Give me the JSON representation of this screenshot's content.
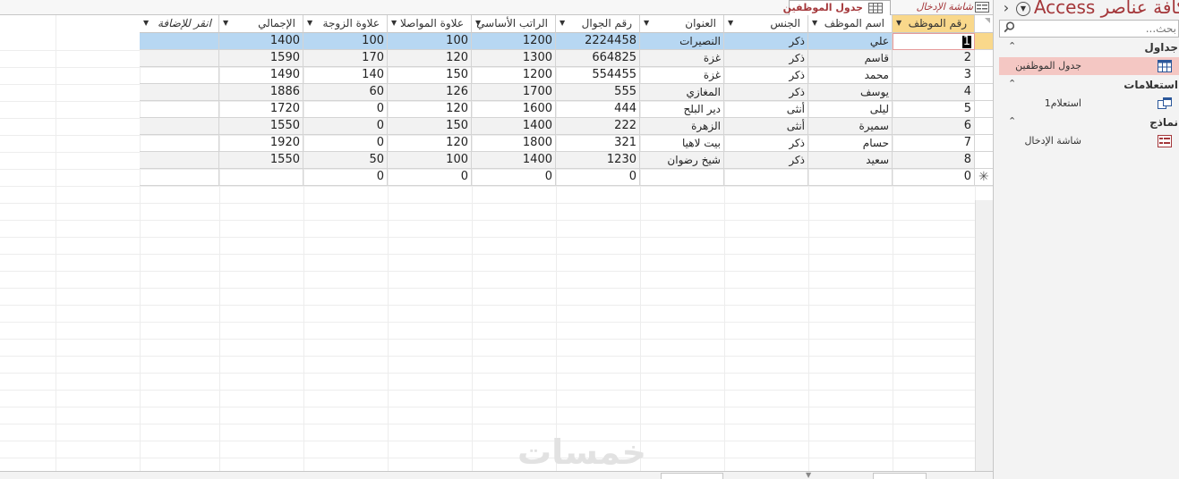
{
  "nav": {
    "title": "كافة عناصر Access",
    "search_placeholder": "بحث...",
    "groups": [
      {
        "label": "جداول",
        "items": [
          {
            "label": "جدول الموظفين",
            "icon": "table-icon",
            "selected": true
          }
        ]
      },
      {
        "label": "استعلامات",
        "items": [
          {
            "label": "استعلام1",
            "icon": "query-icon",
            "selected": false
          }
        ]
      },
      {
        "label": "نماذج",
        "items": [
          {
            "label": "شاشة الإدخال",
            "icon": "form-icon",
            "selected": false
          }
        ]
      }
    ]
  },
  "tabs": [
    {
      "label": "شاشة الإدخال",
      "icon": "form-icon",
      "active": false
    },
    {
      "label": "جدول الموظفين",
      "icon": "table-icon",
      "active": true
    }
  ],
  "columns": [
    "رقم الموظف",
    "اسم الموظف",
    "الجنس",
    "العنوان",
    "رقم الجوال",
    "الراتب الأساسي",
    "علاوة المواصلا",
    "علاوة الزوجة",
    "الإجمالي",
    "انقر للإضافة"
  ],
  "rows": [
    {
      "id": "1",
      "name": "علي",
      "gender": "ذكر",
      "address": "النصيرات",
      "phone": "2224458",
      "salary": "1200",
      "transport": "100",
      "spouse": "100",
      "total": "1400"
    },
    {
      "id": "2",
      "name": "قاسم",
      "gender": "ذكر",
      "address": "غزة",
      "phone": "664825",
      "salary": "1300",
      "transport": "120",
      "spouse": "170",
      "total": "1590"
    },
    {
      "id": "3",
      "name": "محمد",
      "gender": "ذكر",
      "address": "غزة",
      "phone": "554455",
      "salary": "1200",
      "transport": "150",
      "spouse": "140",
      "total": "1490"
    },
    {
      "id": "4",
      "name": "يوسف",
      "gender": "ذكر",
      "address": "المغازي",
      "phone": "555",
      "salary": "1700",
      "transport": "126",
      "spouse": "60",
      "total": "1886"
    },
    {
      "id": "5",
      "name": "ليلى",
      "gender": "أنثى",
      "address": "دير البلح",
      "phone": "444",
      "salary": "1600",
      "transport": "120",
      "spouse": "0",
      "total": "1720"
    },
    {
      "id": "6",
      "name": "سميرة",
      "gender": "أنثى",
      "address": "الزهرة",
      "phone": "222",
      "salary": "1400",
      "transport": "150",
      "spouse": "0",
      "total": "1550"
    },
    {
      "id": "7",
      "name": "حسام",
      "gender": "ذكر",
      "address": "بيت لاهيا",
      "phone": "321",
      "salary": "1800",
      "transport": "120",
      "spouse": "0",
      "total": "1920"
    },
    {
      "id": "8",
      "name": "سعيد",
      "gender": "ذكر",
      "address": "شيخ رضوان",
      "phone": "1230",
      "salary": "1400",
      "transport": "100",
      "spouse": "50",
      "total": "1550"
    }
  ],
  "new_row": {
    "id": "0",
    "phone": "0",
    "salary": "0",
    "transport": "0",
    "spouse": "0"
  },
  "watermark": "خمسات",
  "colors": {
    "accent": "#a4373a",
    "selected_row": "#b7d7f2",
    "selected_header": "#f9d88b",
    "nav_selected": "#f4c7c3"
  }
}
